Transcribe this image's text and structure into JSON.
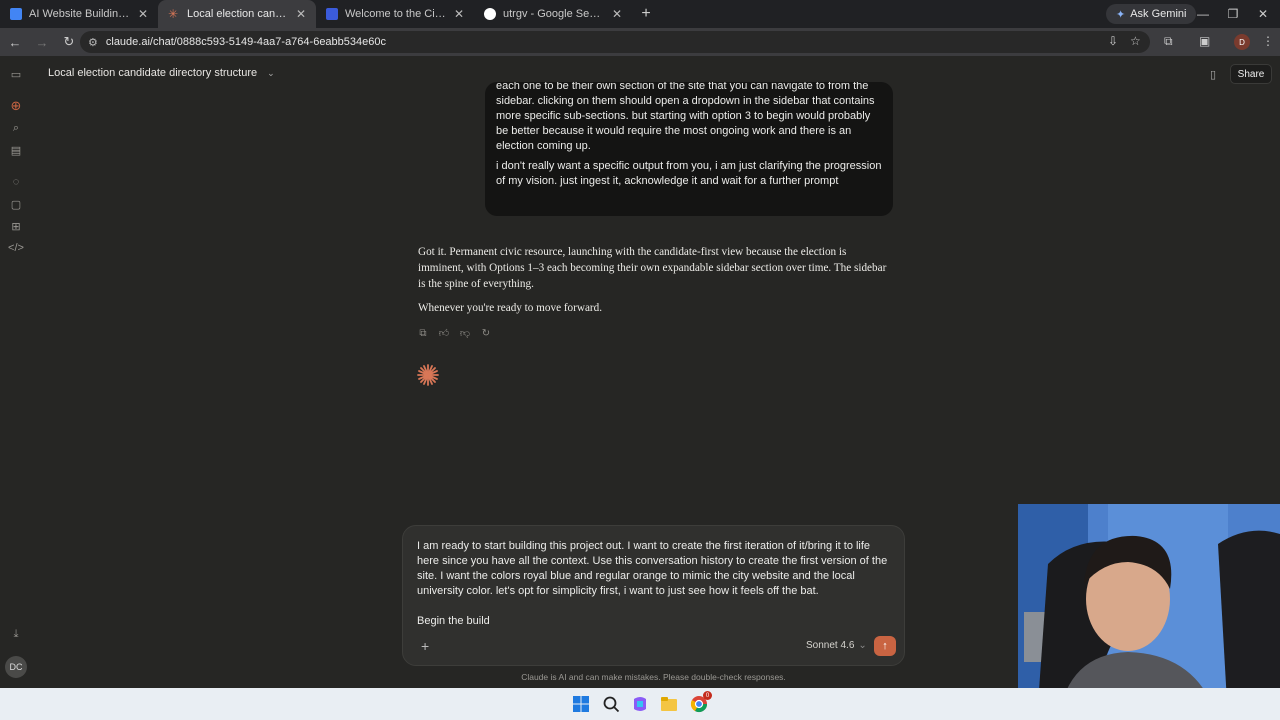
{
  "browser": {
    "tabs": [
      {
        "title": "AI Website Building - Google Do",
        "favicon_color": "#4285f4",
        "active": false
      },
      {
        "title": "Local election candidate directo",
        "favicon_color": "#d97757",
        "active": true
      },
      {
        "title": "Welcome to the City of McAllen",
        "favicon_color": "#3b5bdb",
        "active": false
      },
      {
        "title": "utrgv - Google Search",
        "favicon_color": "#ffffff",
        "active": false
      }
    ],
    "new_tab_icon": "plus-icon",
    "ask_gemini": "Ask Gemini",
    "url": "claude.ai/chat/0888c593-5149-4aa7-a764-6eabb534e60c",
    "profile_initial": "D"
  },
  "app": {
    "chat_title": "Local election candidate directory structure",
    "share_label": "Share",
    "avatar_initials": "DC",
    "user_message": {
      "paragraphs": [
        "each one to be their own section of the site that you can navigate to from the sidebar. clicking on them should open a dropdown in the sidebar that contains more specific sub-sections. but starting with option 3 to begin would probably be better because it would require the most ongoing work and there is an election coming up.",
        "i don't really want a specific output from you, i am just clarifying the progression of my vision. just ingest it, acknowledge it and wait for a further prompt"
      ]
    },
    "assistant_message": {
      "paragraphs": [
        "Got it. Permanent civic resource, launching with the candidate-first view because the election is imminent, with Options 1–3 each becoming their own expandable sidebar section over time. The sidebar is the spine of everything.",
        "Whenever you're ready to move forward."
      ]
    },
    "composer": {
      "paragraphs": [
        "I am ready to start building this project out. I want to create the first iteration of it/bring it to life here since you have all the context. Use this conversation history to create the first version of the site. I want the colors royal blue and regular orange to mimic the city website and the local university color. let's opt for simplicity first, i want to just see how it feels off the bat.",
        "Begin the build"
      ],
      "model": "Sonnet 4.6"
    },
    "disclaimer": "Claude is AI and can make mistakes. Please double-check responses.",
    "accent_color": "#c96442"
  },
  "taskbar": {
    "chrome_badge": "0"
  }
}
